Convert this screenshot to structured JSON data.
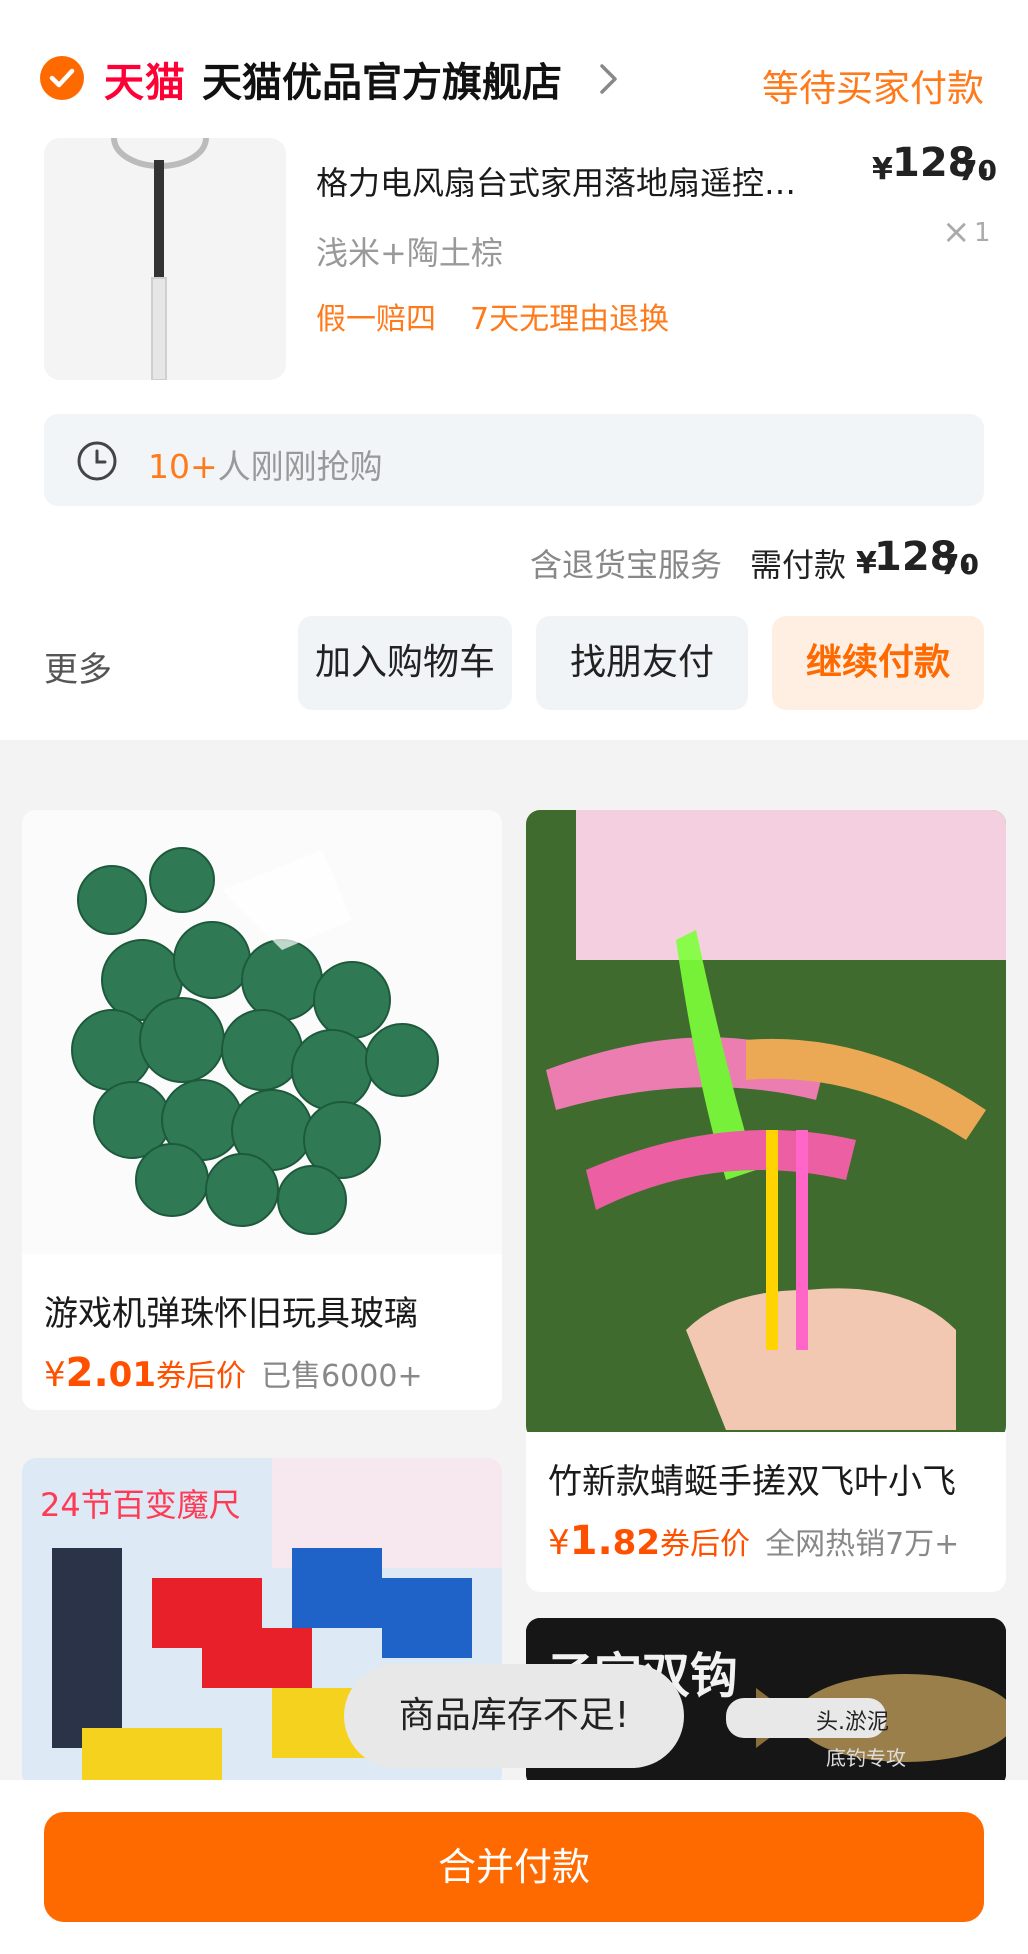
{
  "order": {
    "tmall_logo": "天猫",
    "shop_name": "天猫优品官方旗舰店",
    "status": "等待买家付款",
    "product": {
      "title": "格力电风扇台式家用落地扇遥控…",
      "price_symbol": "¥",
      "price_int": "128.",
      "price_dec": "70",
      "variant": "浅米+陶土棕",
      "qty_x": "×",
      "qty": "1",
      "tags": [
        "假一赔四",
        "7天无理由退换"
      ]
    },
    "hint": {
      "highlight": "10+",
      "text": "人刚刚抢购"
    },
    "payment": {
      "note": "含退货宝服务",
      "label": "需付款",
      "symbol": "¥",
      "int": "128.",
      "dec": "70"
    },
    "actions": {
      "more": "更多",
      "add_to_cart": "加入购物车",
      "friend_pay": "找朋友付",
      "continue_pay": "继续付款"
    }
  },
  "feed": {
    "items": [
      {
        "title": "游戏机弹珠怀旧玩具玻璃",
        "price_symbol": "¥",
        "price_int": "2.",
        "price_dec": "01",
        "price_label": "券后价",
        "sold": "已售6000+"
      },
      {
        "title": "竹新款蜻蜓手搓双飞叶小飞",
        "price_symbol": "¥",
        "price_int": "1.",
        "price_dec": "82",
        "price_label": "券后价",
        "sold": "全网热销7万+"
      },
      {
        "banner_text": "24节百变魔尺"
      },
      {
        "banner_text": "",
        "visible_fragment": "子宫双钩",
        "sub_fragment": "头.淤泥",
        "sub_fragment2": "底钓专攻"
      }
    ]
  },
  "toast": "商品库存不足!",
  "bottom": {
    "merge_pay": "合并付款"
  },
  "colors": {
    "accent": "#ff6a00",
    "tmall_red": "#ff0036",
    "price": "#ff5000"
  }
}
